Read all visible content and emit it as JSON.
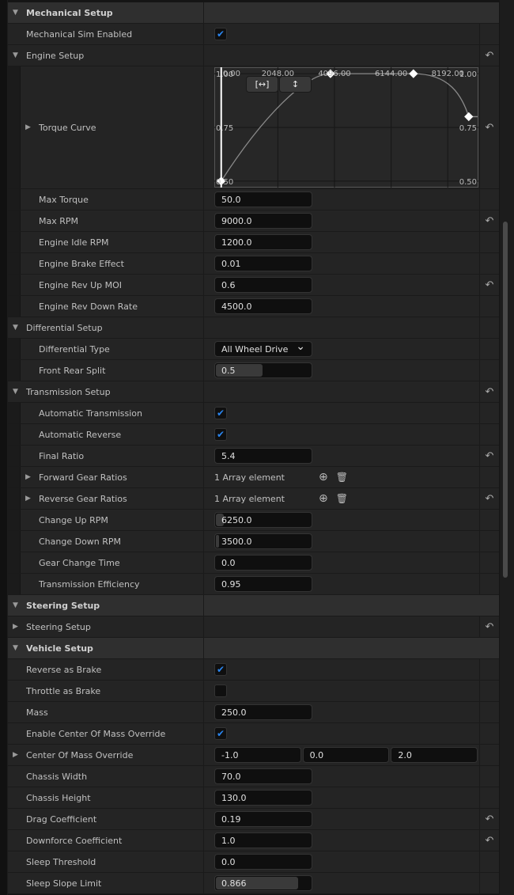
{
  "rows": [
    {
      "kind": "cat",
      "label": "Mechanical Setup",
      "expanded": true
    },
    {
      "kind": "prop",
      "label": "Mechanical Sim Enabled",
      "level": 0,
      "widget": "check",
      "checked": true
    },
    {
      "kind": "group",
      "label": "Engine Setup",
      "level": 0,
      "expanded": true,
      "reset": true
    },
    {
      "kind": "curve",
      "label": "Torque Curve",
      "level": 1,
      "reset": true
    },
    {
      "kind": "prop",
      "label": "Max Torque",
      "level": 1,
      "widget": "num",
      "value": "50.0"
    },
    {
      "kind": "prop",
      "label": "Max RPM",
      "level": 1,
      "widget": "num",
      "value": "9000.0",
      "reset": true
    },
    {
      "kind": "prop",
      "label": "Engine Idle RPM",
      "level": 1,
      "widget": "num",
      "value": "1200.0"
    },
    {
      "kind": "prop",
      "label": "Engine Brake Effect",
      "level": 1,
      "widget": "num",
      "value": "0.01"
    },
    {
      "kind": "prop",
      "label": "Engine Rev Up MOI",
      "level": 1,
      "widget": "num",
      "value": "0.6",
      "reset": true
    },
    {
      "kind": "prop",
      "label": "Engine Rev Down Rate",
      "level": 1,
      "widget": "num",
      "value": "4500.0"
    },
    {
      "kind": "group",
      "label": "Differential Setup",
      "level": 0,
      "expanded": true
    },
    {
      "kind": "prop",
      "label": "Differential Type",
      "level": 1,
      "widget": "combo",
      "value": "All Wheel Drive"
    },
    {
      "kind": "prop",
      "label": "Front Rear Split",
      "level": 1,
      "widget": "num",
      "value": "0.5",
      "fill": 0.48
    },
    {
      "kind": "group",
      "label": "Transmission Setup",
      "level": 0,
      "expanded": true,
      "reset": true
    },
    {
      "kind": "prop",
      "label": "Automatic Transmission",
      "level": 1,
      "widget": "check",
      "checked": true
    },
    {
      "kind": "prop",
      "label": "Automatic Reverse",
      "level": 1,
      "widget": "check",
      "checked": true
    },
    {
      "kind": "prop",
      "label": "Final Ratio",
      "level": 1,
      "widget": "num",
      "value": "5.4",
      "reset": true
    },
    {
      "kind": "arraygroup",
      "label": "Forward Gear Ratios",
      "level": 1,
      "value": "1 Array element"
    },
    {
      "kind": "arraygroup",
      "label": "Reverse Gear Ratios",
      "level": 1,
      "value": "1 Array element",
      "reset": true
    },
    {
      "kind": "prop",
      "label": "Change Up RPM",
      "level": 1,
      "widget": "num",
      "value": "6250.0",
      "fill": 0.08
    },
    {
      "kind": "prop",
      "label": "Change Down RPM",
      "level": 1,
      "widget": "num",
      "value": "3500.0",
      "fill": 0.03
    },
    {
      "kind": "prop",
      "label": "Gear Change Time",
      "level": 1,
      "widget": "num",
      "value": "0.0"
    },
    {
      "kind": "prop",
      "label": "Transmission Efficiency",
      "level": 1,
      "widget": "num",
      "value": "0.95"
    },
    {
      "kind": "cat",
      "label": "Steering Setup",
      "expanded": true
    },
    {
      "kind": "group",
      "label": "Steering Setup",
      "level": 0,
      "expanded": false,
      "reset": true
    },
    {
      "kind": "cat",
      "label": "Vehicle Setup",
      "expanded": true
    },
    {
      "kind": "prop",
      "label": "Reverse as Brake",
      "level": 0,
      "widget": "check",
      "checked": true
    },
    {
      "kind": "prop",
      "label": "Throttle as Brake",
      "level": 0,
      "widget": "check",
      "checked": false
    },
    {
      "kind": "prop",
      "label": "Mass",
      "level": 0,
      "widget": "num",
      "value": "250.0"
    },
    {
      "kind": "prop",
      "label": "Enable Center Of Mass Override",
      "level": 0,
      "widget": "check",
      "checked": true
    },
    {
      "kind": "vecgroup",
      "label": "Center Of Mass Override",
      "level": 0,
      "values": [
        "-1.0",
        "0.0",
        "2.0"
      ]
    },
    {
      "kind": "prop",
      "label": "Chassis Width",
      "level": 0,
      "widget": "num",
      "value": "70.0"
    },
    {
      "kind": "prop",
      "label": "Chassis Height",
      "level": 0,
      "widget": "num",
      "value": "130.0"
    },
    {
      "kind": "prop",
      "label": "Drag Coefficient",
      "level": 0,
      "widget": "num",
      "value": "0.19",
      "reset": true
    },
    {
      "kind": "prop",
      "label": "Downforce Coefficient",
      "level": 0,
      "widget": "num",
      "value": "1.0",
      "reset": true
    },
    {
      "kind": "prop",
      "label": "Sleep Threshold",
      "level": 0,
      "widget": "num",
      "value": "0.0"
    },
    {
      "kind": "prop",
      "label": "Sleep Slope Limit",
      "level": 0,
      "widget": "num",
      "value": "0.866",
      "fill": 0.85
    }
  ],
  "icons": {
    "reset": "reset-to-default-icon",
    "add": "add-element-icon",
    "delete": "delete-icon",
    "check": "checkmark-icon",
    "expand": "expand-arrow-icon",
    "combo": "chevron-down-icon"
  },
  "curve": {
    "x_ticks": [
      "0.00",
      "2048.00",
      "4096.00",
      "6144.00",
      "8192.00"
    ],
    "y_ticks_left": [
      "1.00",
      "0.75",
      "0.50"
    ],
    "y_ticks_right": [
      "1.00",
      "0.75",
      "0.50"
    ],
    "keys": [
      [
        0,
        0.5
      ],
      [
        3950,
        1.0
      ],
      [
        6950,
        1.0
      ],
      [
        8950,
        0.8
      ]
    ],
    "xlim": [
      -250,
      9300
    ],
    "ylim": [
      0.47,
      1.03
    ],
    "fit_h": "[↔]",
    "fit_v": "↕"
  },
  "colors": {
    "accent": "#2a86f0",
    "curve": "#8a8a8a"
  }
}
